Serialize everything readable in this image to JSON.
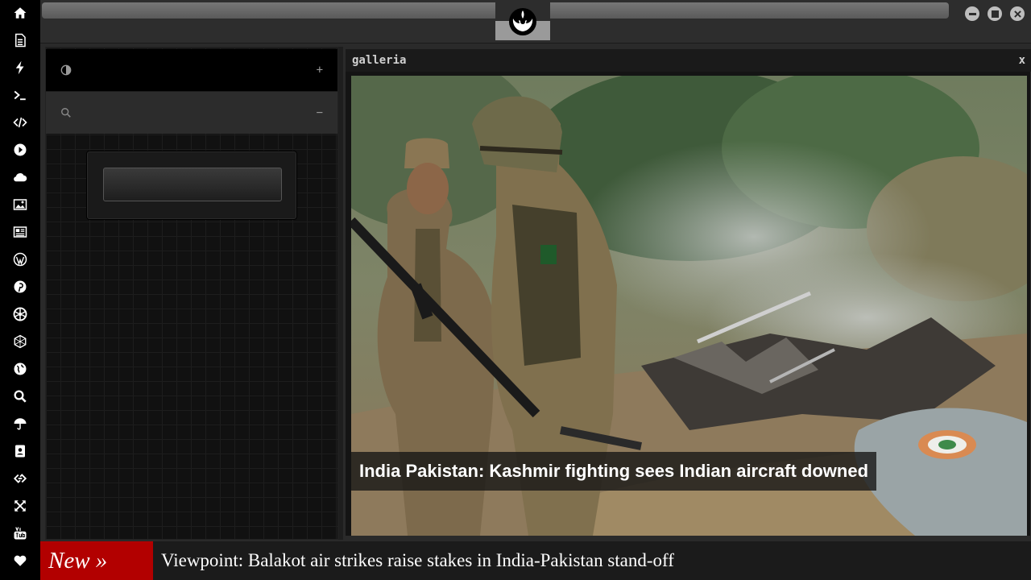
{
  "sidebar": {
    "icons": [
      "home-icon",
      "document-icon",
      "lightning-icon",
      "terminal-icon",
      "code-icon",
      "play-icon",
      "cloud-icon",
      "image-icon",
      "newspaper-icon",
      "wordpress-icon",
      "pinterest-icon",
      "rebel-alliance-icon",
      "globe-wireframe-icon",
      "earth-icon",
      "search-icon",
      "umbrella-icon",
      "contacts-icon",
      "link-icon",
      "expand-icon",
      "youtube-icon",
      "heart-icon"
    ]
  },
  "topbar": {
    "window_controls": [
      "minimize-icon",
      "maximize-icon",
      "close-icon"
    ]
  },
  "left_panel": {
    "contrast_toggle": "+",
    "search_toggle": "−",
    "search_value": ""
  },
  "galleria": {
    "title": "galleria",
    "close": "x",
    "caption": "India Pakistan: Kashmir fighting sees Indian aircraft downed"
  },
  "ticker": {
    "badge": "New »",
    "headline": "Viewpoint: Balakot air strikes raise stakes in India-Pakistan stand-off"
  },
  "colors": {
    "sidebar_bg": "#000000",
    "ticker_badge": "#b20000",
    "panel_bg": "#141414"
  }
}
